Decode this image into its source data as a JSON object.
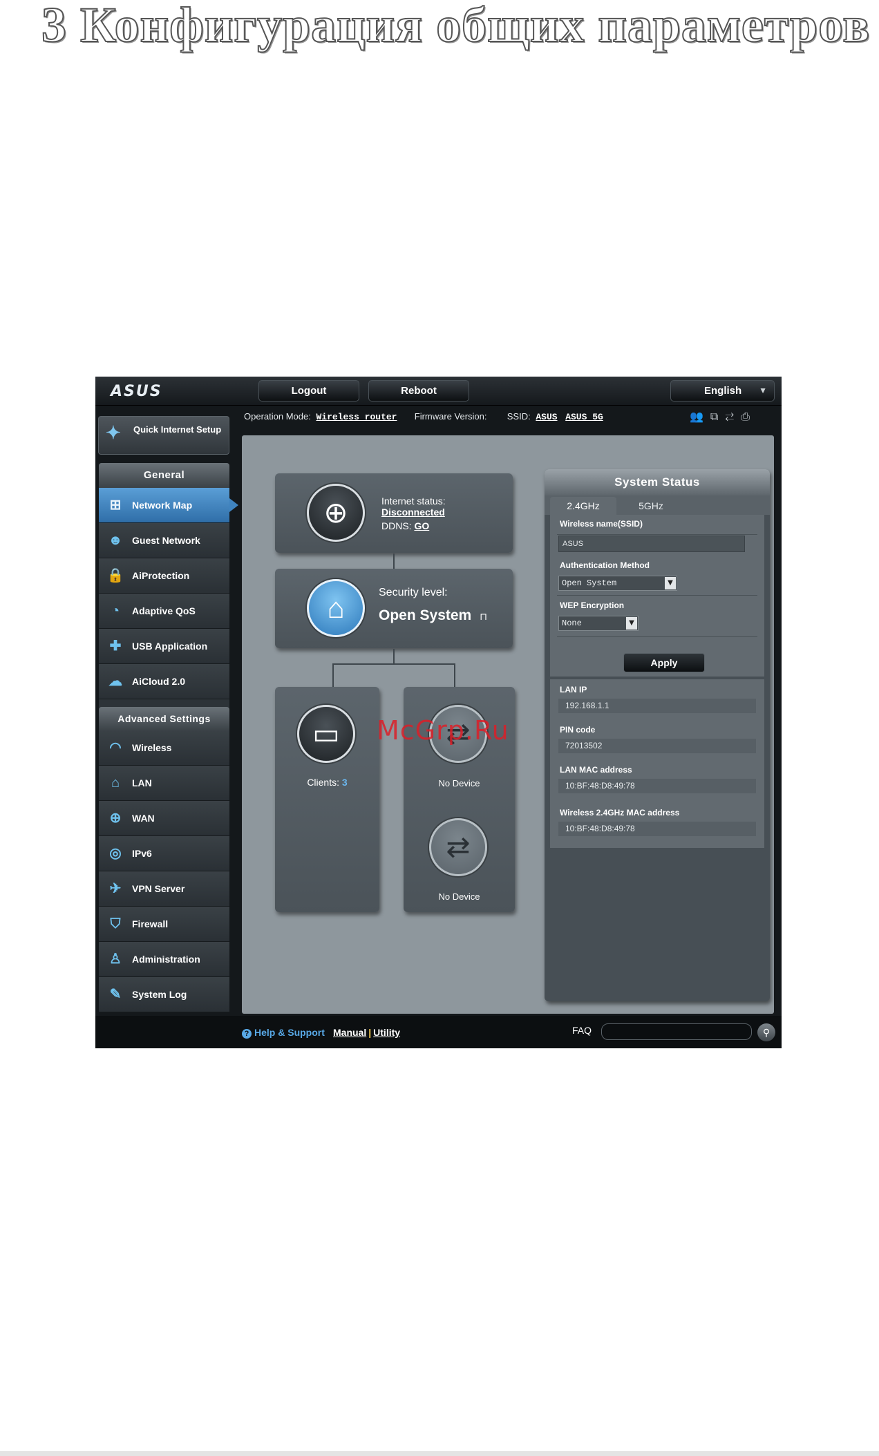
{
  "heading": "3 Конфигурация общих параметров",
  "topbar": {
    "logo": "ASUS",
    "logout": "Logout",
    "reboot": "Reboot",
    "language": "English"
  },
  "infobar": {
    "op_mode_label": "Operation Mode:",
    "op_mode_value": "Wireless router",
    "firmware_label": "Firmware Version:",
    "ssid_label": "SSID:",
    "ssid_1": "ASUS",
    "ssid_2": "ASUS_5G"
  },
  "sidebar": {
    "quick_setup": "Quick Internet Setup",
    "general_title": "General",
    "general_items": [
      {
        "label": "Network Map",
        "icon": "network-map-icon"
      },
      {
        "label": "Guest Network",
        "icon": "guest-network-icon"
      },
      {
        "label": "AiProtection",
        "icon": "lock-icon"
      },
      {
        "label": "Adaptive QoS",
        "icon": "speedometer-icon"
      },
      {
        "label": "USB Application",
        "icon": "puzzle-icon"
      },
      {
        "label": "AiCloud 2.0",
        "icon": "cloud-icon"
      }
    ],
    "advanced_title": "Advanced Settings",
    "advanced_items": [
      {
        "label": "Wireless",
        "icon": "wifi-icon"
      },
      {
        "label": "LAN",
        "icon": "home-icon"
      },
      {
        "label": "WAN",
        "icon": "globe-icon"
      },
      {
        "label": "IPv6",
        "icon": "ipv6-icon"
      },
      {
        "label": "VPN Server",
        "icon": "vpn-icon"
      },
      {
        "label": "Firewall",
        "icon": "shield-icon"
      },
      {
        "label": "Administration",
        "icon": "user-icon"
      },
      {
        "label": "System Log",
        "icon": "log-icon"
      }
    ]
  },
  "map": {
    "internet_status_label": "Internet status:",
    "internet_status_value": "Disconnected",
    "ddns_label": "DDNS:",
    "ddns_value": "GO",
    "security_label": "Security level:",
    "security_value": "Open System",
    "clients_label": "Clients:",
    "clients_count": "3",
    "usb_1": "No Device",
    "usb_2": "No Device",
    "watermark": "McGrp.Ru"
  },
  "system_status": {
    "title": "System Status",
    "tabs": [
      "2.4GHz",
      "5GHz"
    ],
    "ssid_label": "Wireless name(SSID)",
    "ssid_value": "ASUS",
    "auth_label": "Authentication Method",
    "auth_value": "Open System",
    "wep_label": "WEP Encryption",
    "wep_value": "None",
    "apply": "Apply",
    "lan_ip_label": "LAN IP",
    "lan_ip_value": "192.168.1.1",
    "pin_label": "PIN code",
    "pin_value": "72013502",
    "lan_mac_label": "LAN MAC address",
    "lan_mac_value": "10:BF:48:D8:49:78",
    "wl_mac_label": "Wireless 2.4GHz MAC address",
    "wl_mac_value": "10:BF:48:D8:49:78"
  },
  "footer": {
    "help": "Help & Support",
    "manual": "Manual",
    "separator": "|",
    "utility": "Utility",
    "faq": "FAQ"
  }
}
